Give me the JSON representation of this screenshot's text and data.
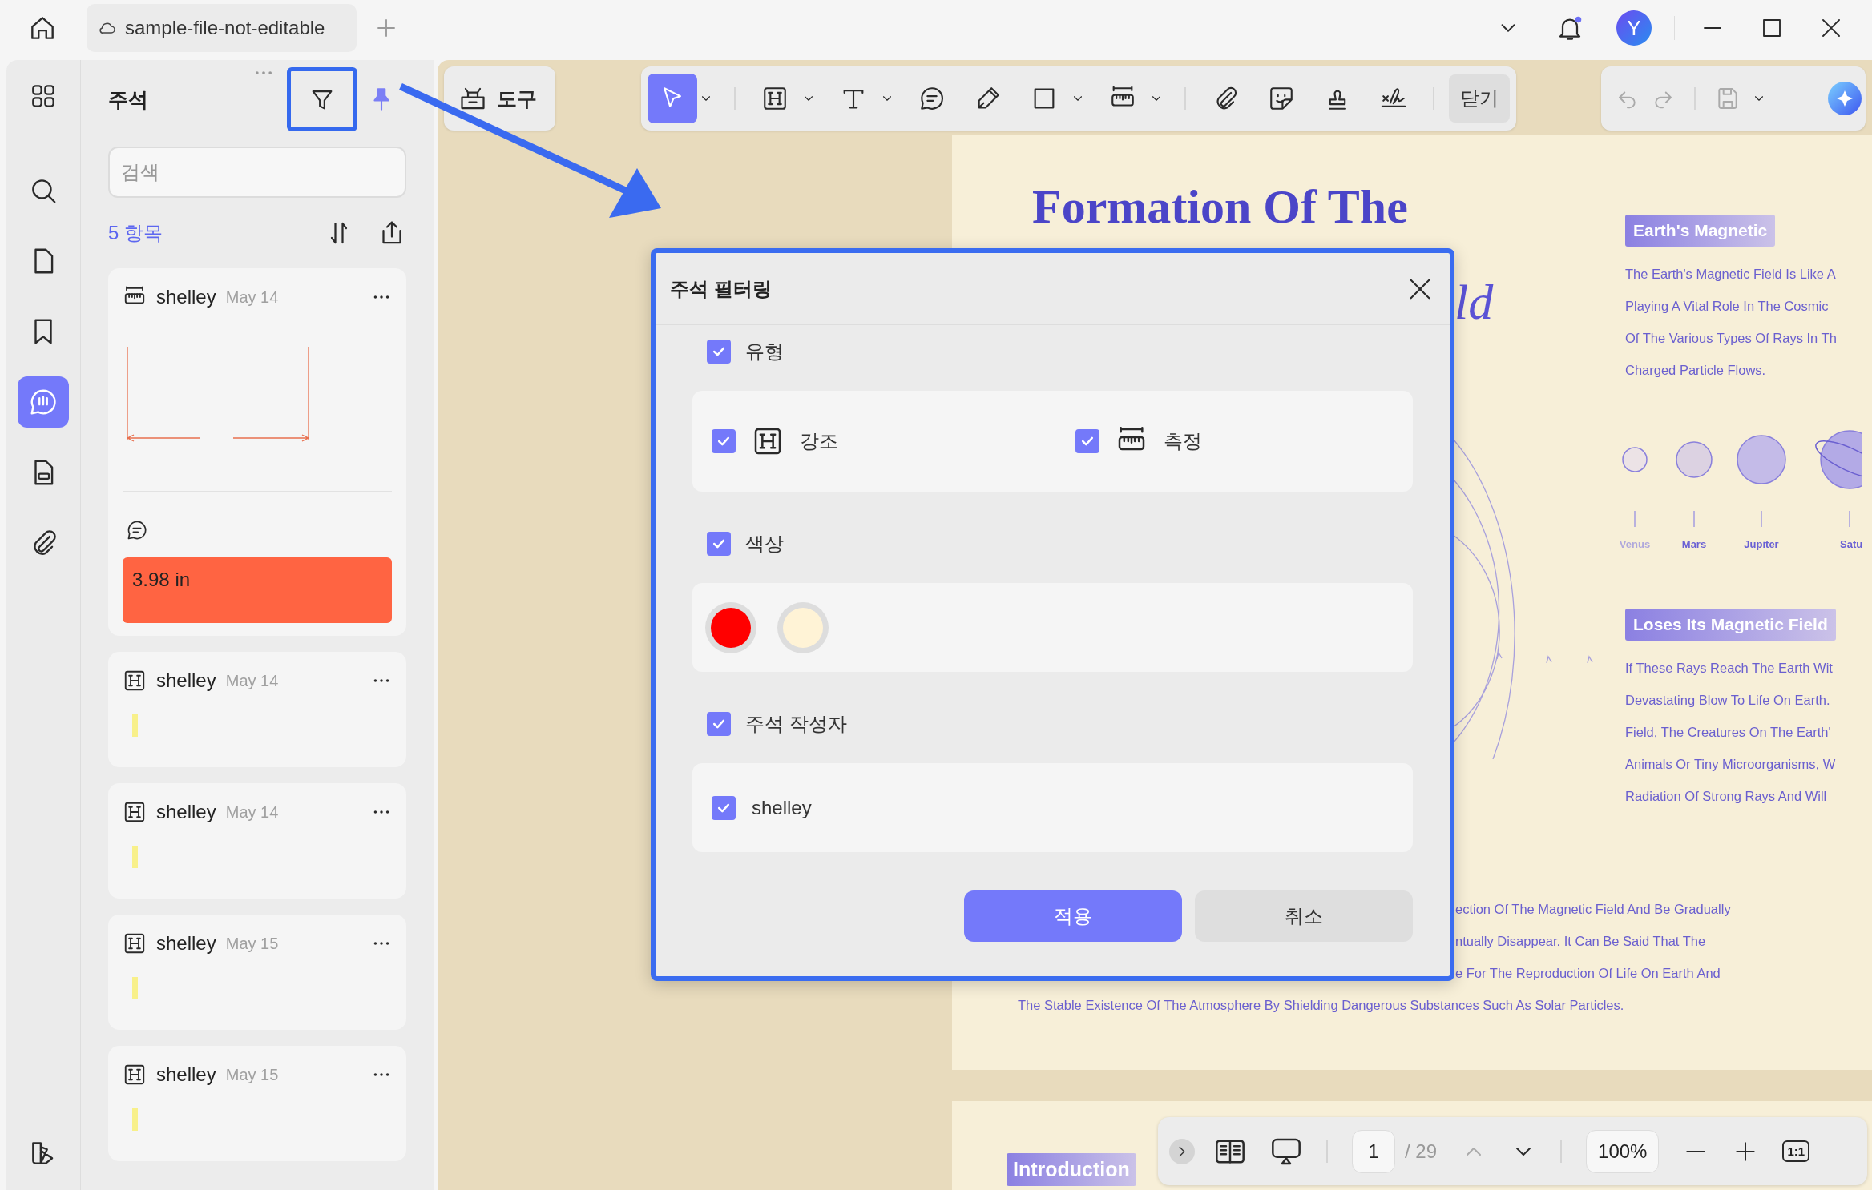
{
  "tab": {
    "title": "sample-file-not-editable"
  },
  "account": {
    "avatar": "Y"
  },
  "rail": [
    {
      "kind": "thumbnails",
      "selected": false
    },
    {
      "kind": "search",
      "selected": false
    },
    {
      "kind": "pages",
      "selected": false
    },
    {
      "kind": "bookmark",
      "selected": false
    },
    {
      "kind": "comments",
      "selected": true
    },
    {
      "kind": "form",
      "selected": false
    },
    {
      "kind": "attachment",
      "selected": false
    }
  ],
  "panel": {
    "title": "주석",
    "search": {
      "placeholder": "검색"
    },
    "count": "5 항목"
  },
  "annotations": [
    {
      "kind": "measure",
      "author": "shelley",
      "date": "May 14",
      "comment": "3.98 in"
    },
    {
      "kind": "highlight",
      "author": "shelley",
      "date": "May 14"
    },
    {
      "kind": "highlight",
      "author": "shelley",
      "date": "May 14"
    },
    {
      "kind": "highlight",
      "author": "shelley",
      "date": "May 15"
    },
    {
      "kind": "highlight",
      "author": "shelley",
      "date": "May 15"
    }
  ],
  "toolbar": {
    "tools_label": "도구",
    "close_label": "닫기",
    "tools": [
      {
        "kind": "select",
        "selected": true,
        "dropdown": true
      },
      {
        "kind": "highlight",
        "selected": false,
        "dropdown": true
      },
      {
        "kind": "text",
        "selected": false,
        "dropdown": true
      },
      {
        "kind": "comment",
        "selected": false,
        "dropdown": false
      },
      {
        "kind": "pencil",
        "selected": false,
        "dropdown": false
      },
      {
        "kind": "rectangle",
        "selected": false,
        "dropdown": true
      },
      {
        "kind": "measure",
        "selected": false,
        "dropdown": true
      },
      {
        "kind": "attachment",
        "selected": false,
        "dropdown": false
      },
      {
        "kind": "sticker",
        "selected": false,
        "dropdown": false
      },
      {
        "kind": "stamp",
        "selected": false,
        "dropdown": false
      },
      {
        "kind": "signature",
        "selected": false,
        "dropdown": false
      }
    ]
  },
  "document": {
    "title": "Formation Of The",
    "title_fragment": "ld",
    "sections": [
      {
        "heading": "Earth's Magnetic",
        "lines": [
          "The Earth's Magnetic Field Is Like A",
          "Playing A Vital Role In The Cosmic",
          "Of The Various Types Of Rays In Th",
          "Charged Particle Flows."
        ]
      },
      {
        "heading": "Loses Its Magnetic Field",
        "lines": [
          "If These Rays Reach The Earth Wit",
          "Devastating Blow To Life On Earth.",
          "Field, The Creatures On The Earth'",
          "Animals Or Tiny Microorganisms, W",
          "Radiation Of Strong Rays And Will"
        ]
      }
    ],
    "planets": [
      "Venus",
      "Mars",
      "Jupiter",
      "Satu"
    ],
    "paragraph": [
      "ection Of The Magnetic Field And Be Gradually",
      "ntually Disappear. It Can Be Said That The",
      "e For The Reproduction Of Life On Earth And",
      "The Stable Existence Of The Atmosphere By Shielding Dangerous Substances Such As Solar Particles."
    ],
    "next_page_badge": "Introduction"
  },
  "page_nav": {
    "page": "1",
    "total": "/ 29",
    "zoom": "100%",
    "actual_size": "1:1"
  },
  "dialog": {
    "title": "주석 필터링",
    "sections": [
      {
        "kind": "types",
        "label": "유형",
        "checked": true,
        "options": [
          {
            "kind": "highlight",
            "label": "강조",
            "checked": true
          },
          {
            "kind": "measure",
            "label": "측정",
            "checked": true
          }
        ]
      },
      {
        "kind": "colors",
        "label": "색상",
        "checked": true,
        "colors": [
          {
            "color": "#ff0000"
          },
          {
            "color": "#fff3d6"
          }
        ]
      },
      {
        "kind": "authors",
        "label": "주석 작성자",
        "checked": true,
        "options": [
          {
            "label": "shelley",
            "checked": true
          }
        ]
      }
    ],
    "apply": "적용",
    "cancel": "취소"
  }
}
